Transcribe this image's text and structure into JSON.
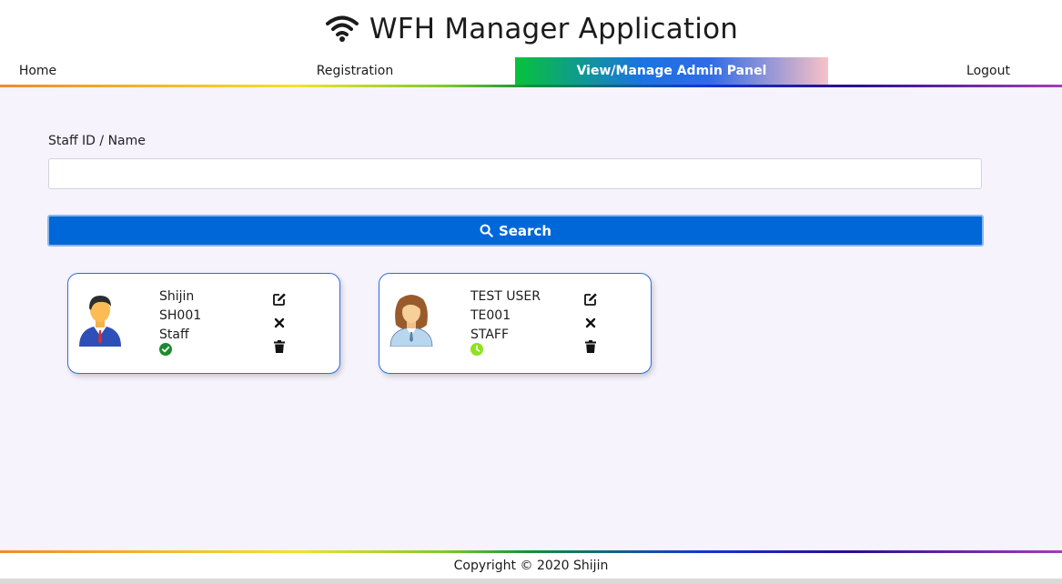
{
  "header": {
    "title": "WFH Manager Application",
    "icon": "wifi-icon"
  },
  "nav": {
    "home": "Home",
    "registration": "Registration",
    "admin_panel": "View/Manage Admin Panel",
    "logout": "Logout"
  },
  "search": {
    "label": "Staff ID / Name",
    "value": "",
    "placeholder": "",
    "button_label": "Search"
  },
  "staff": [
    {
      "name": "Shijin",
      "id": "SH001",
      "role": "Staff",
      "status": "approved",
      "status_color": "#1e8a2e"
    },
    {
      "name": "TEST USER",
      "id": "TE001",
      "role": "STAFF",
      "status": "pending",
      "status_color": "#8ee31c"
    }
  ],
  "footer": {
    "copyright": "Copyright © 2020 Shijin"
  },
  "colors": {
    "primary": "#0067d9",
    "card_border": "#2b70e0",
    "background": "#f6f3fd"
  }
}
